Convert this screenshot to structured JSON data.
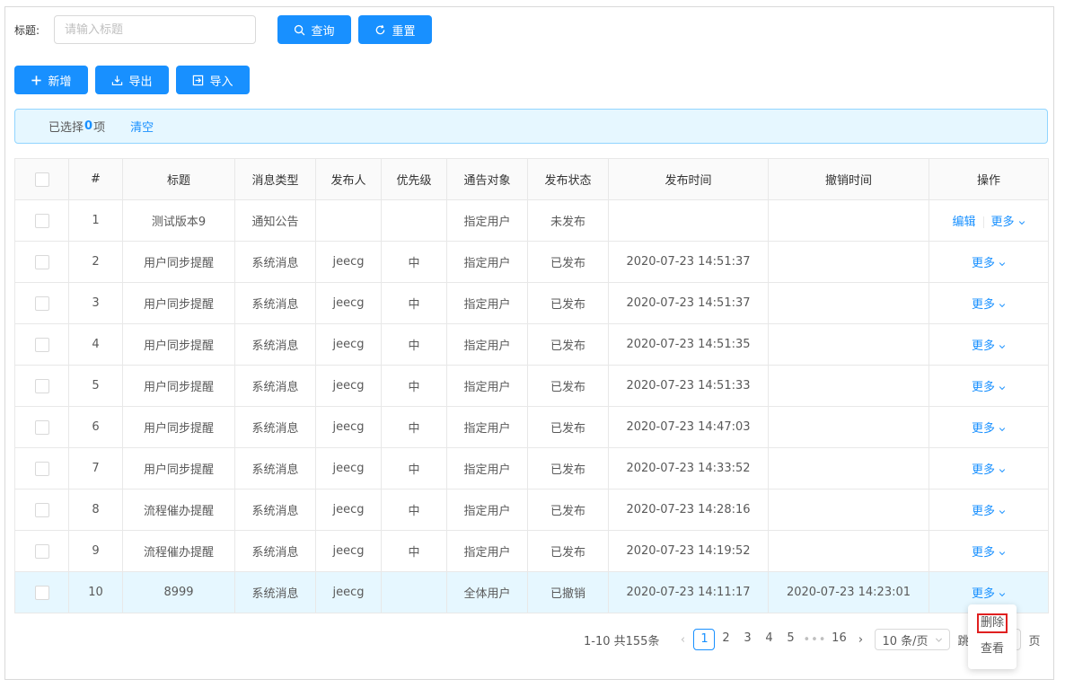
{
  "search": {
    "label": "标题:",
    "placeholder": "请输入标题",
    "query_label": "查询",
    "reset_label": "重置"
  },
  "toolbar": {
    "add_label": "新增",
    "export_label": "导出",
    "import_label": "导入"
  },
  "alert": {
    "prefix": "已选择",
    "count": "0",
    "suffix": "项",
    "clear_label": "清空"
  },
  "table": {
    "columns": [
      "#",
      "标题",
      "消息类型",
      "发布人",
      "优先级",
      "通告对象",
      "发布状态",
      "发布时间",
      "撤销时间",
      "操作"
    ],
    "edit_label": "编辑",
    "more_label": "更多",
    "rows": [
      {
        "no": "1",
        "title": "测试版本9",
        "type": "通知公告",
        "sender": "",
        "priority": "",
        "target": "指定用户",
        "status": "未发布",
        "send_time": "",
        "cancel_time": "",
        "editable": true
      },
      {
        "no": "2",
        "title": "用户同步提醒",
        "type": "系统消息",
        "sender": "jeecg",
        "priority": "中",
        "target": "指定用户",
        "status": "已发布",
        "send_time": "2020-07-23 14:51:37",
        "cancel_time": "",
        "editable": false
      },
      {
        "no": "3",
        "title": "用户同步提醒",
        "type": "系统消息",
        "sender": "jeecg",
        "priority": "中",
        "target": "指定用户",
        "status": "已发布",
        "send_time": "2020-07-23 14:51:37",
        "cancel_time": "",
        "editable": false
      },
      {
        "no": "4",
        "title": "用户同步提醒",
        "type": "系统消息",
        "sender": "jeecg",
        "priority": "中",
        "target": "指定用户",
        "status": "已发布",
        "send_time": "2020-07-23 14:51:35",
        "cancel_time": "",
        "editable": false
      },
      {
        "no": "5",
        "title": "用户同步提醒",
        "type": "系统消息",
        "sender": "jeecg",
        "priority": "中",
        "target": "指定用户",
        "status": "已发布",
        "send_time": "2020-07-23 14:51:33",
        "cancel_time": "",
        "editable": false
      },
      {
        "no": "6",
        "title": "用户同步提醒",
        "type": "系统消息",
        "sender": "jeecg",
        "priority": "中",
        "target": "指定用户",
        "status": "已发布",
        "send_time": "2020-07-23 14:47:03",
        "cancel_time": "",
        "editable": false
      },
      {
        "no": "7",
        "title": "用户同步提醒",
        "type": "系统消息",
        "sender": "jeecg",
        "priority": "中",
        "target": "指定用户",
        "status": "已发布",
        "send_time": "2020-07-23 14:33:52",
        "cancel_time": "",
        "editable": false
      },
      {
        "no": "8",
        "title": "流程催办提醒",
        "type": "系统消息",
        "sender": "jeecg",
        "priority": "中",
        "target": "指定用户",
        "status": "已发布",
        "send_time": "2020-07-23 14:28:16",
        "cancel_time": "",
        "editable": false
      },
      {
        "no": "9",
        "title": "流程催办提醒",
        "type": "系统消息",
        "sender": "jeecg",
        "priority": "中",
        "target": "指定用户",
        "status": "已发布",
        "send_time": "2020-07-23 14:19:52",
        "cancel_time": "",
        "editable": false
      },
      {
        "no": "10",
        "title": "8999",
        "type": "系统消息",
        "sender": "jeecg",
        "priority": "",
        "target": "全体用户",
        "status": "已撤销",
        "send_time": "2020-07-23 14:11:17",
        "cancel_time": "2020-07-23 14:23:01",
        "editable": false
      }
    ]
  },
  "pagination": {
    "total_text": "1-10 共155条",
    "pages": [
      "1",
      "2",
      "3",
      "4",
      "5"
    ],
    "current": "1",
    "ellipsis": "•••",
    "last_page": "16",
    "page_size": "10 条/页",
    "jump_label": "跳",
    "page_suffix": "页"
  },
  "dropdown": {
    "delete_label": "删除",
    "view_label": "查看"
  },
  "colors": {
    "primary": "#1890ff",
    "alert_bg": "#e6f7ff",
    "highlight_box": "#e02020"
  }
}
